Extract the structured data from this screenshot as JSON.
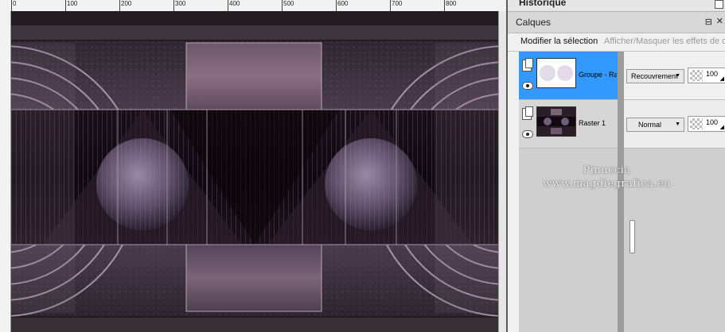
{
  "ruler": {
    "top_labels": [
      "0",
      "100",
      "200",
      "300",
      "400",
      "500",
      "600",
      "700",
      "800"
    ]
  },
  "panel": {
    "historique": {
      "title": "Historique"
    },
    "calques": {
      "title": "Calques",
      "pin_icon": "pin-icon",
      "close_icon": "close-icon",
      "toolbar": {
        "modifier_label": "Modifier la sélection",
        "afficher_label": "Afficher/Masquer les effets de c"
      },
      "layers": [
        {
          "name": "Groupe - Ra",
          "blend_mode": "Recouvrement",
          "opacity": "100",
          "selected": true
        },
        {
          "name": "Raster 1",
          "blend_mode": "Normal",
          "opacity": "100",
          "selected": false
        }
      ]
    }
  },
  "watermark": {
    "line1": "Pinuccia",
    "line2": "www.magdiegrafica.eu"
  },
  "colors": {
    "canvas_bg": "#c8c8c8",
    "selection_blue": "#3399ff",
    "image_dark": "#120810",
    "image_mauve": "#6e5870"
  }
}
